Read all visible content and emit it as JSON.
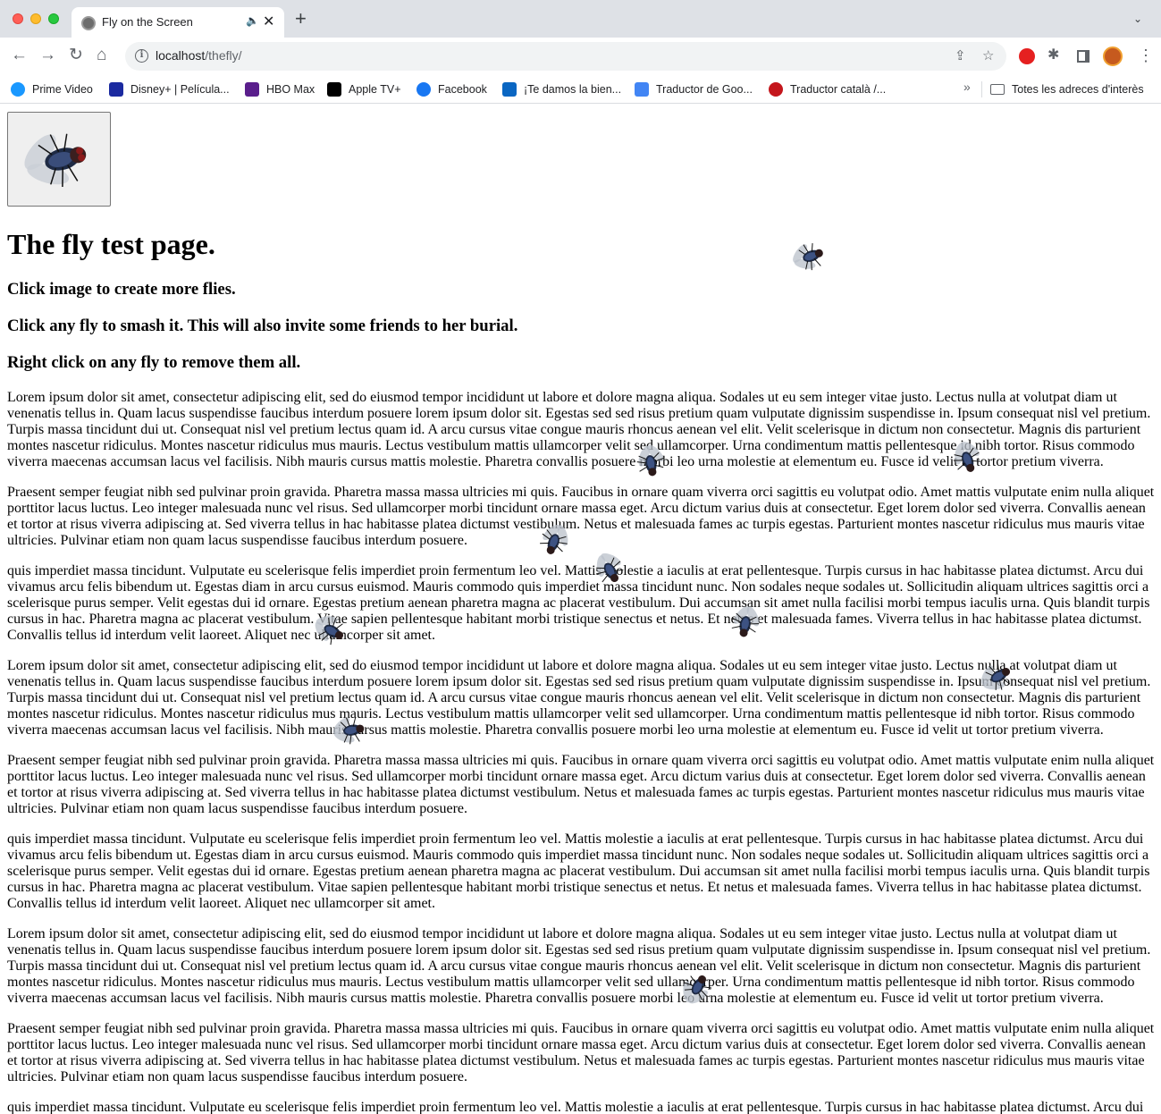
{
  "browser": {
    "tab_title": "Fly on the Screen",
    "tab_close": "✕",
    "new_tab": "+",
    "tab_menu": "⌄",
    "url_host": "localhost",
    "url_path": "/thefly/",
    "bookmarks": [
      {
        "label": "Prime Video",
        "icon": "prime-video-icon",
        "color": "#1a98ff"
      },
      {
        "label": "Disney+ | Película...",
        "icon": "disney-plus-icon",
        "color": "#1b2aa0"
      },
      {
        "label": "HBO Max",
        "icon": "hbo-max-icon",
        "color": "#5a1e8c"
      },
      {
        "label": "Apple TV+",
        "icon": "apple-tv-icon",
        "color": "#000000"
      },
      {
        "label": "Facebook",
        "icon": "facebook-icon",
        "color": "#1877f2"
      },
      {
        "label": "¡Te damos la bien...",
        "icon": "linkedin-icon",
        "color": "#0a66c2"
      },
      {
        "label": "Traductor de Goo...",
        "icon": "google-translate-icon",
        "color": "#4285f4"
      },
      {
        "label": "Traductor català /...",
        "icon": "softcatala-icon",
        "color": "#c4161c"
      }
    ],
    "bookmarks_more": "»",
    "all_bookmarks": "Totes les adreces d'interès"
  },
  "page": {
    "title": "The fly test page.",
    "instructions": [
      "Click image to create more flies.",
      "Click any fly to smash it. This will also invite some friends to her burial.",
      "Right click on any fly to remove them all."
    ],
    "paragraphs": [
      "Lorem ipsum dolor sit amet, consectetur adipiscing elit, sed do eiusmod tempor incididunt ut labore et dolore magna aliqua. Sodales ut eu sem integer vitae justo. Lectus nulla at volutpat diam ut venenatis tellus in. Quam lacus suspendisse faucibus interdum posuere lorem ipsum dolor sit. Egestas sed sed risus pretium quam vulputate dignissim suspendisse in. Ipsum consequat nisl vel pretium. Turpis massa tincidunt dui ut. Consequat nisl vel pretium lectus quam id. A arcu cursus vitae congue mauris rhoncus aenean vel elit. Velit scelerisque in dictum non consectetur. Magnis dis parturient montes nascetur ridiculus. Montes nascetur ridiculus mus mauris. Lectus vestibulum mattis ullamcorper velit sed ullamcorper. Urna condimentum mattis pellentesque id nibh tortor. Risus commodo viverra maecenas accumsan lacus vel facilisis. Nibh mauris cursus mattis molestie. Pharetra convallis posuere morbi leo urna molestie at elementum eu. Fusce id velit ut tortor pretium viverra.",
      "Praesent semper feugiat nibh sed pulvinar proin gravida. Pharetra massa massa ultricies mi quis. Faucibus in ornare quam viverra orci sagittis eu volutpat odio. Amet mattis vulputate enim nulla aliquet porttitor lacus luctus. Leo integer malesuada nunc vel risus. Sed ullamcorper morbi tincidunt ornare massa eget. Arcu dictum varius duis at consectetur. Eget lorem dolor sed viverra. Convallis aenean et tortor at risus viverra adipiscing at. Sed viverra tellus in hac habitasse platea dictumst vestibulum. Netus et malesuada fames ac turpis egestas. Parturient montes nascetur ridiculus mus mauris vitae ultricies. Pulvinar etiam non quam lacus suspendisse faucibus interdum posuere.",
      "quis imperdiet massa tincidunt. Vulputate eu scelerisque felis imperdiet proin fermentum leo vel. Mattis molestie a iaculis at erat pellentesque. Turpis cursus in hac habitasse platea dictumst. Arcu dui vivamus arcu felis bibendum ut. Egestas diam in arcu cursus euismod. Mauris commodo quis imperdiet massa tincidunt nunc. Non sodales neque sodales ut. Sollicitudin aliquam ultrices sagittis orci a scelerisque purus semper. Velit egestas dui id ornare. Egestas pretium aenean pharetra magna ac placerat vestibulum. Dui accumsan sit amet nulla facilisi morbi tempus iaculis urna. Quis blandit turpis cursus in hac. Pharetra magna ac placerat vestibulum. Vitae sapien pellentesque habitant morbi tristique senectus et netus. Et netus et malesuada fames. Viverra tellus in hac habitasse platea dictumst. Convallis tellus id interdum velit laoreet. Aliquet nec ullamcorper sit amet.",
      "Lorem ipsum dolor sit amet, consectetur adipiscing elit, sed do eiusmod tempor incididunt ut labore et dolore magna aliqua. Sodales ut eu sem integer vitae justo. Lectus nulla at volutpat diam ut venenatis tellus in. Quam lacus suspendisse faucibus interdum posuere lorem ipsum dolor sit. Egestas sed sed risus pretium quam vulputate dignissim suspendisse in. Ipsum consequat nisl vel pretium. Turpis massa tincidunt dui ut. Consequat nisl vel pretium lectus quam id. A arcu cursus vitae congue mauris rhoncus aenean vel elit. Velit scelerisque in dictum non consectetur. Magnis dis parturient montes nascetur ridiculus. Montes nascetur ridiculus mus mauris. Lectus vestibulum mattis ullamcorper velit sed ullamcorper. Urna condimentum mattis pellentesque id nibh tortor. Risus commodo viverra maecenas accumsan lacus vel facilisis. Nibh mauris cursus mattis molestie. Pharetra convallis posuere morbi leo urna molestie at elementum eu. Fusce id velit ut tortor pretium viverra.",
      "Praesent semper feugiat nibh sed pulvinar proin gravida. Pharetra massa massa ultricies mi quis. Faucibus in ornare quam viverra orci sagittis eu volutpat odio. Amet mattis vulputate enim nulla aliquet porttitor lacus luctus. Leo integer malesuada nunc vel risus. Sed ullamcorper morbi tincidunt ornare massa eget. Arcu dictum varius duis at consectetur. Eget lorem dolor sed viverra. Convallis aenean et tortor at risus viverra adipiscing at. Sed viverra tellus in hac habitasse platea dictumst vestibulum. Netus et malesuada fames ac turpis egestas. Parturient montes nascetur ridiculus mus mauris vitae ultricies. Pulvinar etiam non quam lacus suspendisse faucibus interdum posuere.",
      "quis imperdiet massa tincidunt. Vulputate eu scelerisque felis imperdiet proin fermentum leo vel. Mattis molestie a iaculis at erat pellentesque. Turpis cursus in hac habitasse platea dictumst. Arcu dui vivamus arcu felis bibendum ut. Egestas diam in arcu cursus euismod. Mauris commodo quis imperdiet massa tincidunt nunc. Non sodales neque sodales ut. Sollicitudin aliquam ultrices sagittis orci a scelerisque purus semper. Velit egestas dui id ornare. Egestas pretium aenean pharetra magna ac placerat vestibulum. Dui accumsan sit amet nulla facilisi morbi tempus iaculis urna. Quis blandit turpis cursus in hac. Pharetra magna ac placerat vestibulum. Vitae sapien pellentesque habitant morbi tristique senectus et netus. Et netus et malesuada fames. Viverra tellus in hac habitasse platea dictumst. Convallis tellus id interdum velit laoreet. Aliquet nec ullamcorper sit amet.",
      "Lorem ipsum dolor sit amet, consectetur adipiscing elit, sed do eiusmod tempor incididunt ut labore et dolore magna aliqua. Sodales ut eu sem integer vitae justo. Lectus nulla at volutpat diam ut venenatis tellus in. Quam lacus suspendisse faucibus interdum posuere lorem ipsum dolor sit. Egestas sed sed risus pretium quam vulputate dignissim suspendisse in. Ipsum consequat nisl vel pretium. Turpis massa tincidunt dui ut. Consequat nisl vel pretium lectus quam id. A arcu cursus vitae congue mauris rhoncus aenean vel elit. Velit scelerisque in dictum non consectetur. Magnis dis parturient montes nascetur ridiculus. Montes nascetur ridiculus mus mauris. Lectus vestibulum mattis ullamcorper velit sed ullamcorper. Urna condimentum mattis pellentesque id nibh tortor. Risus commodo viverra maecenas accumsan lacus vel facilisis. Nibh mauris cursus mattis molestie. Pharetra convallis posuere morbi leo urna molestie at elementum eu. Fusce id velit ut tortor pretium viverra.",
      "Praesent semper feugiat nibh sed pulvinar proin gravida. Pharetra massa massa ultricies mi quis. Faucibus in ornare quam viverra orci sagittis eu volutpat odio. Amet mattis vulputate enim nulla aliquet porttitor lacus luctus. Leo integer malesuada nunc vel risus. Sed ullamcorper morbi tincidunt ornare massa eget. Arcu dictum varius duis at consectetur. Eget lorem dolor sed viverra. Convallis aenean et tortor at risus viverra adipiscing at. Sed viverra tellus in hac habitasse platea dictumst vestibulum. Netus et malesuada fames ac turpis egestas. Parturient montes nascetur ridiculus mus mauris vitae ultricies. Pulvinar etiam non quam lacus suspendisse faucibus interdum posuere.",
      "quis imperdiet massa tincidunt. Vulputate eu scelerisque felis imperdiet proin fermentum leo vel. Mattis molestie a iaculis at erat pellentesque. Turpis cursus in hac habitasse platea dictumst. Arcu dui vivamus arcu felis bibendum ut."
    ]
  }
}
